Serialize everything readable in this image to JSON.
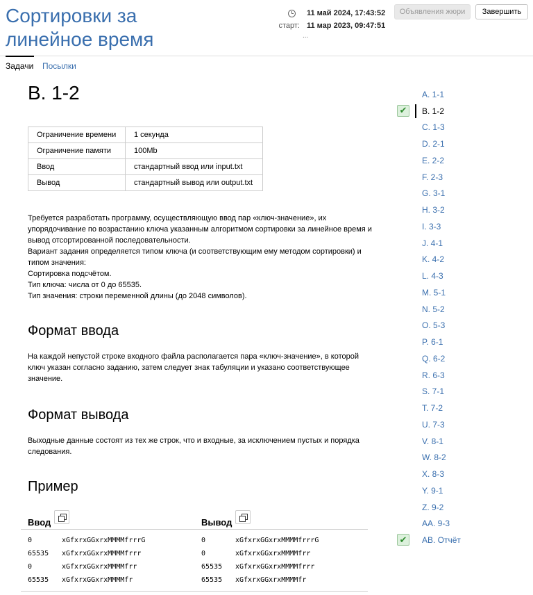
{
  "contest_title": "Сортировки за линейное время",
  "meta": {
    "current_time": "11 май 2024, 17:43:52",
    "start_label": "старт:",
    "start_time": "11 мар 2023, 09:47:51",
    "more": "..."
  },
  "buttons": {
    "jury": "Объявления жюри",
    "finish": "Завершить"
  },
  "tabs": {
    "problems": "Задачи",
    "submissions": "Посылки"
  },
  "problem": {
    "title": "B. 1-2",
    "limits": [
      {
        "key": "Ограничение времени",
        "value": "1 секунда"
      },
      {
        "key": "Ограничение памяти",
        "value": "100Mb"
      },
      {
        "key": "Ввод",
        "value": "стандартный ввод или input.txt"
      },
      {
        "key": "Вывод",
        "value": "стандартный вывод или output.txt"
      }
    ],
    "statement": [
      "Требуется разработать программу, осуществляющую ввод пар «ключ-значение», их упорядочивание по возрастанию ключа указанным алгоритмом сортировки за линейное время и вывод отсортированной последовательности.",
      "Вариант задания определяется типом ключа (и соответствующим ему методом сортировки) и типом значения:",
      "Сортировка подсчётом.",
      "Тип ключа: числа от 0 до 65535.",
      "Тип значения: строки переменной длины (до 2048 символов)."
    ],
    "input_heading": "Формат ввода",
    "input_text": "На каждой непустой строке входного файла располагается пара «ключ-значение», в которой ключ указан согласно заданию, затем следует знак табуляции и указано соответствующее значение.",
    "output_heading": "Формат вывода",
    "output_text": "Выходные данные состоят из тех же строк, что и входные, за исключением пустых и порядка следования.",
    "example_heading": "Пример",
    "input_label": "Ввод",
    "output_label": "Вывод",
    "sample_input": [
      {
        "k": "0",
        "v": "xGfxrxGGxrxMMMMfrrrG"
      },
      {
        "k": "65535",
        "v": "xGfxrxGGxrxMMMMfrrr"
      },
      {
        "k": "0",
        "v": "xGfxrxGGxrxMMMMfrr"
      },
      {
        "k": "65535",
        "v": "xGfxrxGGxrxMMMMfr"
      }
    ],
    "sample_output": [
      {
        "k": "0",
        "v": "xGfxrxGGxrxMMMMfrrrG"
      },
      {
        "k": "0",
        "v": "xGfxrxGGxrxMMMMfrr"
      },
      {
        "k": "65535",
        "v": "xGfxrxGGxrxMMMMfrrr"
      },
      {
        "k": "65535",
        "v": "xGfxrxGGxrxMMMMfr"
      }
    ]
  },
  "nav": [
    {
      "label": "A. 1-1",
      "done": false,
      "active": false
    },
    {
      "label": "B. 1-2",
      "done": true,
      "active": true
    },
    {
      "label": "C. 1-3",
      "done": false,
      "active": false
    },
    {
      "label": "D. 2-1",
      "done": false,
      "active": false
    },
    {
      "label": "E. 2-2",
      "done": false,
      "active": false
    },
    {
      "label": "F. 2-3",
      "done": false,
      "active": false
    },
    {
      "label": "G. 3-1",
      "done": false,
      "active": false
    },
    {
      "label": "H. 3-2",
      "done": false,
      "active": false
    },
    {
      "label": "I. 3-3",
      "done": false,
      "active": false
    },
    {
      "label": "J. 4-1",
      "done": false,
      "active": false
    },
    {
      "label": "K. 4-2",
      "done": false,
      "active": false
    },
    {
      "label": "L. 4-3",
      "done": false,
      "active": false
    },
    {
      "label": "M. 5-1",
      "done": false,
      "active": false
    },
    {
      "label": "N. 5-2",
      "done": false,
      "active": false
    },
    {
      "label": "O. 5-3",
      "done": false,
      "active": false
    },
    {
      "label": "P. 6-1",
      "done": false,
      "active": false
    },
    {
      "label": "Q. 6-2",
      "done": false,
      "active": false
    },
    {
      "label": "R. 6-3",
      "done": false,
      "active": false
    },
    {
      "label": "S. 7-1",
      "done": false,
      "active": false
    },
    {
      "label": "T. 7-2",
      "done": false,
      "active": false
    },
    {
      "label": "U. 7-3",
      "done": false,
      "active": false
    },
    {
      "label": "V. 8-1",
      "done": false,
      "active": false
    },
    {
      "label": "W. 8-2",
      "done": false,
      "active": false
    },
    {
      "label": "X. 8-3",
      "done": false,
      "active": false
    },
    {
      "label": "Y. 9-1",
      "done": false,
      "active": false
    },
    {
      "label": "Z. 9-2",
      "done": false,
      "active": false
    },
    {
      "label": "AA. 9-3",
      "done": false,
      "active": false
    },
    {
      "label": "AB. Отчёт",
      "done": true,
      "active": false
    }
  ]
}
